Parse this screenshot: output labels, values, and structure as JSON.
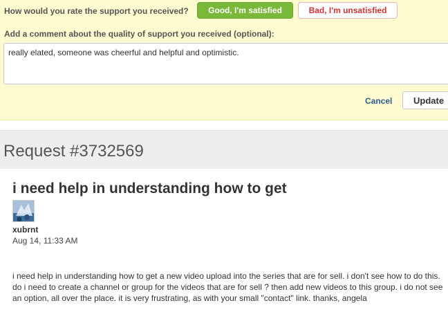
{
  "rating": {
    "question": "How would you rate the support you received?",
    "good_label": "Good, I'm satisfied",
    "bad_label": "Bad, I'm unsatisfied",
    "comment_label": "Add a comment about the quality of support you received (optional):",
    "comment_value": "really elated, someone was cheerful and helpful and optimistic.",
    "cancel_label": "Cancel",
    "update_label": "Update"
  },
  "request": {
    "title": "Request #3732569",
    "subject": "i need help in understanding how to get",
    "author": "xubrnt",
    "timestamp": "Aug 14, 11:33 AM",
    "message": "i need help in understanding how to get a new video upload into the series that are for sell. i don't see how to do this. do i need to create a channel or group for the videos that are for sell ? then add new videos to this group. i do not see an option, all over the place. it is very frustrating, as with your small \"contact\" link. thanks, angela"
  },
  "icons": {
    "avatar": "user-avatar-photo"
  },
  "colors": {
    "panel_background": "#fdfbcf",
    "good_button": "#79b838",
    "bad_button_text": "#d63333",
    "cancel_link": "#2d5f8f",
    "header_background": "#eeeeee"
  }
}
